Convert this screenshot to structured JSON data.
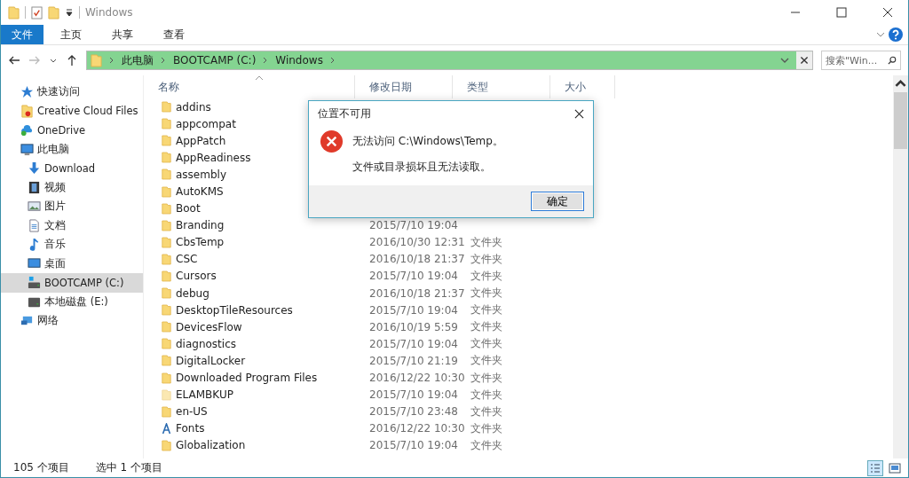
{
  "window": {
    "title": "Windows"
  },
  "ribbon_tabs": [
    {
      "label": "文件",
      "selected": true
    },
    {
      "label": "主页",
      "selected": false
    },
    {
      "label": "共享",
      "selected": false
    },
    {
      "label": "查看",
      "selected": false
    }
  ],
  "breadcrumb": [
    "此电脑",
    "BOOTCAMP (C:)",
    "Windows"
  ],
  "search": {
    "placeholder": "搜索\"Win..."
  },
  "sidebar": {
    "items": [
      {
        "label": "快速访问",
        "kind": "star",
        "selected": false
      },
      {
        "label": "Creative Cloud Files",
        "kind": "cloudfolder",
        "selected": false
      },
      {
        "label": "OneDrive",
        "kind": "onedrive",
        "selected": false
      },
      {
        "label": "此电脑",
        "kind": "pc",
        "selected": false,
        "children": [
          {
            "label": "Download",
            "kind": "download",
            "selected": false
          },
          {
            "label": "视频",
            "kind": "video",
            "selected": false
          },
          {
            "label": "图片",
            "kind": "image",
            "selected": false
          },
          {
            "label": "文档",
            "kind": "doc",
            "selected": false
          },
          {
            "label": "音乐",
            "kind": "music",
            "selected": false
          },
          {
            "label": "桌面",
            "kind": "desktop",
            "selected": false
          },
          {
            "label": "BOOTCAMP (C:)",
            "kind": "sysdrive",
            "selected": true
          },
          {
            "label": "本地磁盘 (E:)",
            "kind": "drive",
            "selected": false
          }
        ]
      },
      {
        "label": "网络",
        "kind": "network",
        "selected": false
      }
    ]
  },
  "table": {
    "columns": [
      "名称",
      "修改日期",
      "类型",
      "大小"
    ],
    "rows": [
      {
        "name": "addins",
        "kind": "folder"
      },
      {
        "name": "appcompat",
        "kind": "folder"
      },
      {
        "name": "AppPatch",
        "kind": "folder"
      },
      {
        "name": "AppReadiness",
        "kind": "folder"
      },
      {
        "name": "assembly",
        "kind": "folder"
      },
      {
        "name": "AutoKMS",
        "kind": "folder"
      },
      {
        "name": "Boot",
        "kind": "folder"
      },
      {
        "name": "Branding",
        "kind": "folder",
        "date": "2015/7/10 19:04"
      },
      {
        "name": "CbsTemp",
        "kind": "folder",
        "date": "2016/10/30 12:31",
        "type": "文件夹"
      },
      {
        "name": "CSC",
        "kind": "folder",
        "date": "2016/10/18 21:37",
        "type": "文件夹"
      },
      {
        "name": "Cursors",
        "kind": "folder",
        "date": "2015/7/10 19:04",
        "type": "文件夹"
      },
      {
        "name": "debug",
        "kind": "folder",
        "date": "2016/10/18 21:37",
        "type": "文件夹"
      },
      {
        "name": "DesktopTileResources",
        "kind": "folder",
        "date": "2015/7/10 19:04",
        "type": "文件夹"
      },
      {
        "name": "DevicesFlow",
        "kind": "folder",
        "date": "2016/10/19 5:59",
        "type": "文件夹"
      },
      {
        "name": "diagnostics",
        "kind": "folder",
        "date": "2015/7/10 19:04",
        "type": "文件夹"
      },
      {
        "name": "DigitalLocker",
        "kind": "folder",
        "date": "2015/7/10 21:19",
        "type": "文件夹"
      },
      {
        "name": "Downloaded Program Files",
        "kind": "folder",
        "date": "2016/12/22 10:30",
        "type": "文件夹"
      },
      {
        "name": "ELAMBKUP",
        "kind": "hidden",
        "date": "2015/7/10 19:04",
        "type": "文件夹"
      },
      {
        "name": "en-US",
        "kind": "folder",
        "date": "2015/7/10 23:48",
        "type": "文件夹"
      },
      {
        "name": "Fonts",
        "kind": "fonts",
        "date": "2016/12/22 10:30",
        "type": "文件夹"
      },
      {
        "name": "Globalization",
        "kind": "folder",
        "date": "2015/7/10 19:04",
        "type": "文件夹"
      }
    ]
  },
  "dialog": {
    "title": "位置不可用",
    "message": "无法访问 C:\\Windows\\Temp。",
    "detail": "文件或目录损坏且无法读取。",
    "button": "确定"
  },
  "status_bar": {
    "count": "105 个项目",
    "selection": "选中 1 个项目"
  }
}
